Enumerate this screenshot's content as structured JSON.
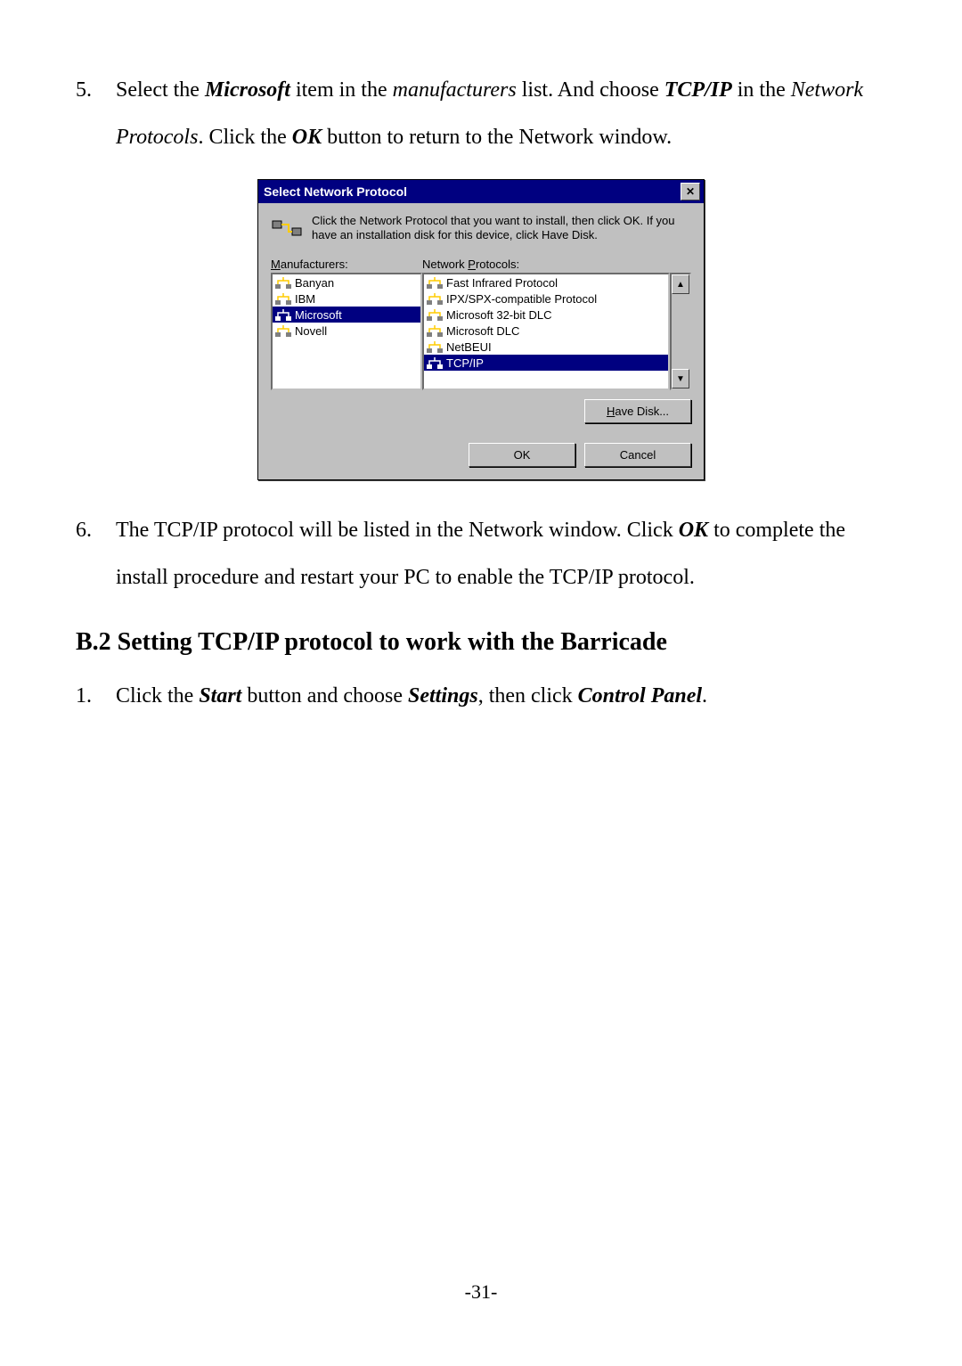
{
  "steps": {
    "five": {
      "num": "5.",
      "textA": "Select the ",
      "bold1": "Microsoft",
      "textB": " item in the ",
      "italic1": "manufacturers",
      "textC": " list. And choose ",
      "bold2": "TCP/IP",
      "textD": " in the ",
      "italic2": "Network Protocols",
      "textE": ". Click the ",
      "bold3": "OK",
      "textF": " button to return to the Network window."
    },
    "six": {
      "num": "6.",
      "textA": "The TCP/IP protocol will be listed in the Network window. Click ",
      "bold1": "OK",
      "textB": " to complete the install procedure and restart your PC to enable the TCP/IP protocol."
    },
    "one": {
      "num": "1.",
      "textA": "Click the ",
      "bold1": "Start",
      "textB": " button and choose ",
      "bold2": "Settings",
      "textC": ", then click ",
      "bold3": "Control Panel",
      "textD": "."
    }
  },
  "heading": "B.2 Setting TCP/IP protocol to work with the Barricade",
  "dialog": {
    "title": "Select Network Protocol",
    "close": "✕",
    "description": "Click the Network Protocol that you want to install, then click OK. If you have an installation disk for this device, click Have Disk.",
    "manufacturers_label_u": "M",
    "manufacturers_label": "anufacturers:",
    "protocols_label_u": "P",
    "protocols_label_pre": "Network ",
    "protocols_label": "rotocols:",
    "manufacturers": [
      "Banyan",
      "IBM",
      "Microsoft",
      "Novell"
    ],
    "manufacturers_selected_index": 2,
    "protocols": [
      "Fast Infrared Protocol",
      "IPX/SPX-compatible Protocol",
      "Microsoft 32-bit DLC",
      "Microsoft DLC",
      "NetBEUI",
      "TCP/IP"
    ],
    "protocols_selected_index": 5,
    "have_disk_u": "H",
    "have_disk": "ave Disk...",
    "ok": "OK",
    "cancel": "Cancel",
    "scroll_up": "▲",
    "scroll_down": "▼"
  },
  "page_number": "-31-"
}
